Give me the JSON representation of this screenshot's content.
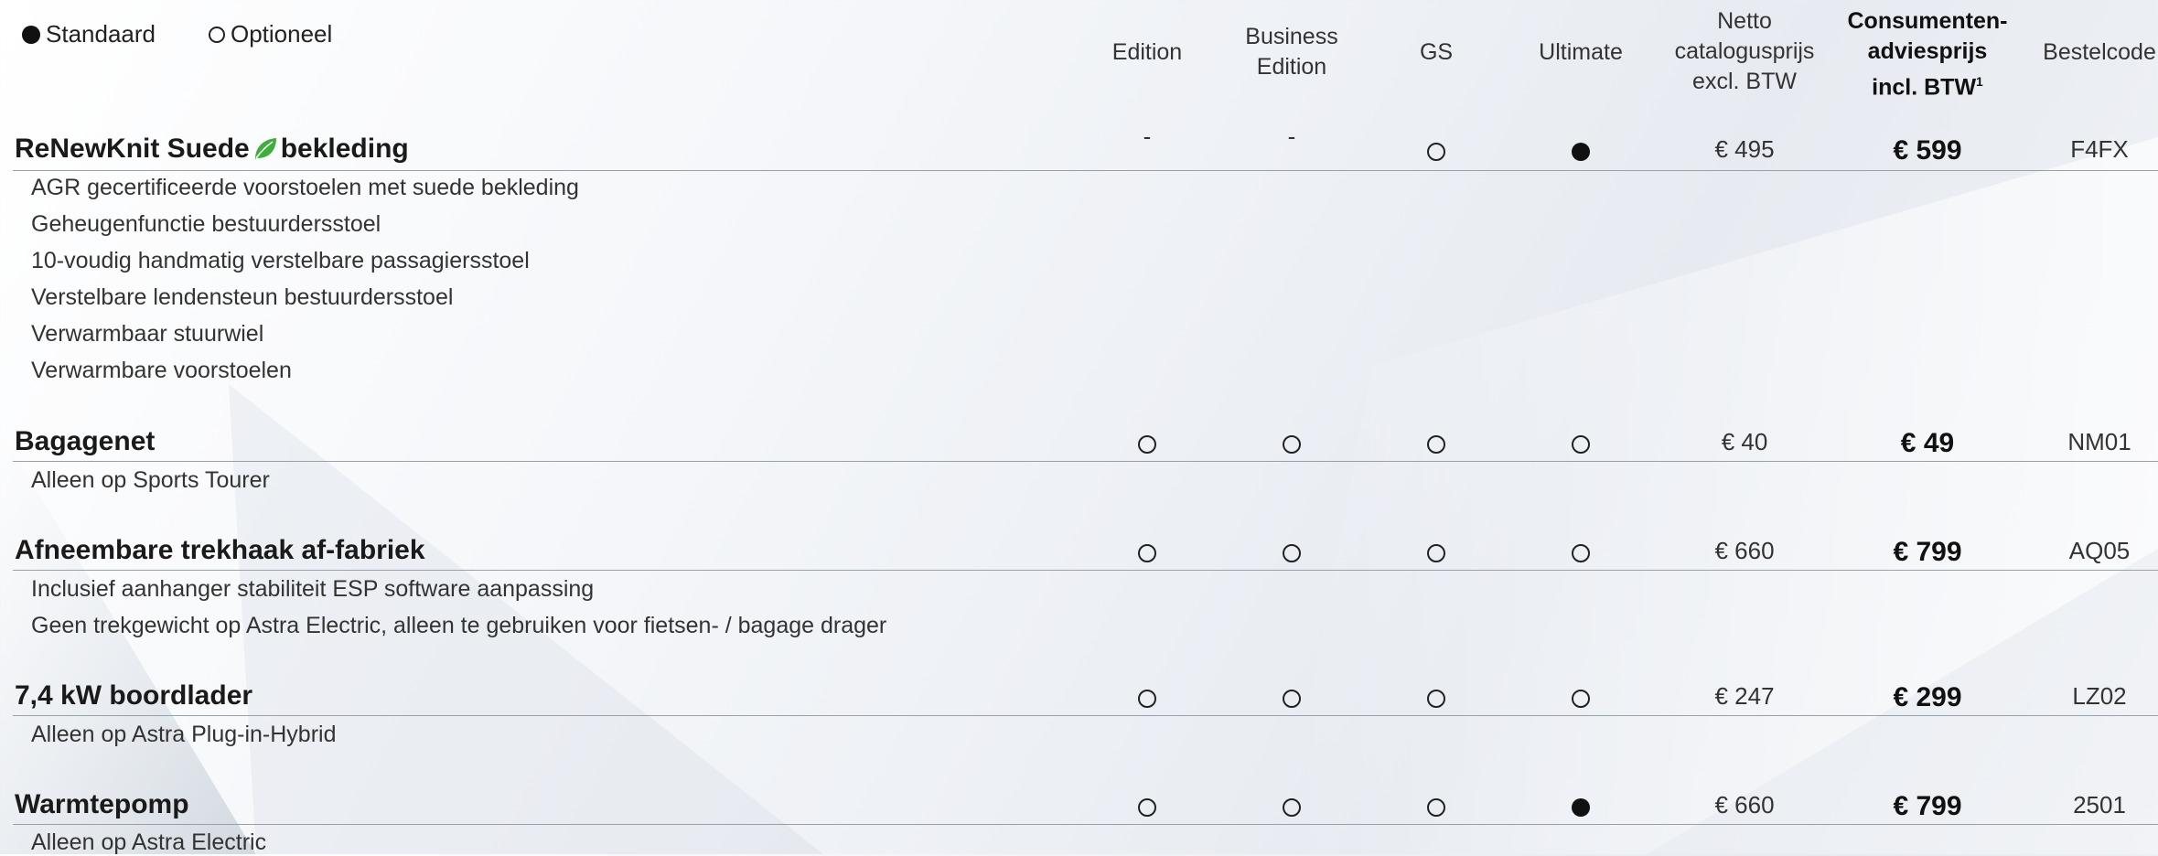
{
  "legend": {
    "standard": "Standaard",
    "optional": "Optioneel"
  },
  "columns": {
    "edition": "Edition",
    "business_edition_1": "Business",
    "business_edition_2": "Edition",
    "gs": "GS",
    "ultimate": "Ultimate",
    "net_1": "Netto",
    "net_2": "catalogusprijs",
    "net_3": "excl. BTW",
    "consumer_1": "Consumenten-",
    "consumer_2": "adviesprijs",
    "consumer_3": "incl. BTW",
    "consumer_footnote": "1",
    "code": "Bestelcode"
  },
  "rows": [
    {
      "title_part1": "ReNewKnit Suede",
      "title_part2": "bekleding",
      "edition": "-",
      "business": "-",
      "gs": "optional",
      "ultimate": "standard",
      "net": "€ 495",
      "consumer": "€ 599",
      "code": "F4FX",
      "details": [
        "AGR gecertificeerde voorstoelen met suede bekleding",
        "Geheugenfunctie bestuurdersstoel",
        "10-voudig handmatig verstelbare passagiersstoel",
        "Verstelbare lendensteun bestuurdersstoel",
        "Verwarmbaar stuurwiel",
        "Verwarmbare voorstoelen"
      ]
    },
    {
      "title": "Bagagenet",
      "edition": "optional",
      "business": "optional",
      "gs": "optional",
      "ultimate": "optional",
      "net": "€ 40",
      "consumer": "€ 49",
      "code": "NM01",
      "details": [
        "Alleen op Sports Tourer"
      ]
    },
    {
      "title": "Afneembare trekhaak af-fabriek",
      "edition": "optional",
      "business": "optional",
      "gs": "optional",
      "ultimate": "optional",
      "net": "€ 660",
      "consumer": "€ 799",
      "code": "AQ05",
      "details": [
        "Inclusief aanhanger stabiliteit ESP software aanpassing",
        "Geen trekgewicht op Astra Electric, alleen te gebruiken voor fietsen- / bagage drager"
      ]
    },
    {
      "title": "7,4 kW boordlader",
      "edition": "optional",
      "business": "optional",
      "gs": "optional",
      "ultimate": "optional",
      "net": "€ 247",
      "consumer": "€ 299",
      "code": "LZ02",
      "details": [
        "Alleen op Astra Plug-in-Hybrid"
      ]
    },
    {
      "title": "Warmtepomp",
      "edition": "optional",
      "business": "optional",
      "gs": "optional",
      "ultimate": "standard",
      "net": "€ 660",
      "consumer": "€ 799",
      "code": "2501",
      "details": [
        "Alleen op Astra Electric"
      ]
    }
  ],
  "colors": {
    "text": "#222222",
    "rule": "#9aa0a8",
    "leaf": "#3fae3a"
  }
}
